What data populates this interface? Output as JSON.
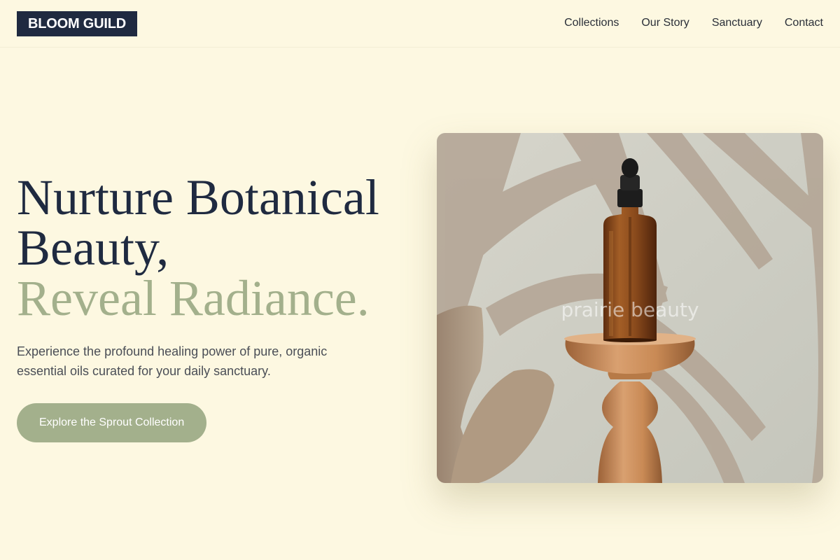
{
  "brand": {
    "name": "BLOOM GUILD"
  },
  "nav": {
    "items": [
      {
        "label": "Collections"
      },
      {
        "label": "Our Story"
      },
      {
        "label": "Sanctuary"
      },
      {
        "label": "Contact"
      }
    ]
  },
  "hero": {
    "headline_line1": "Nurture Botanical",
    "headline_line2": "Beauty,",
    "headline_accent": "Reveal Radiance.",
    "subtitle": "Experience the profound healing power of pure, organic essential oils curated for your daily sanctuary.",
    "cta_label": "Explore the Sprout Collection",
    "image_watermark": "prairie beauty"
  },
  "colors": {
    "background": "#fdf8e1",
    "navy": "#1f2a40",
    "sage": "#a3b08c",
    "amber": "#8a4a1c",
    "wood": "#c98a55"
  }
}
